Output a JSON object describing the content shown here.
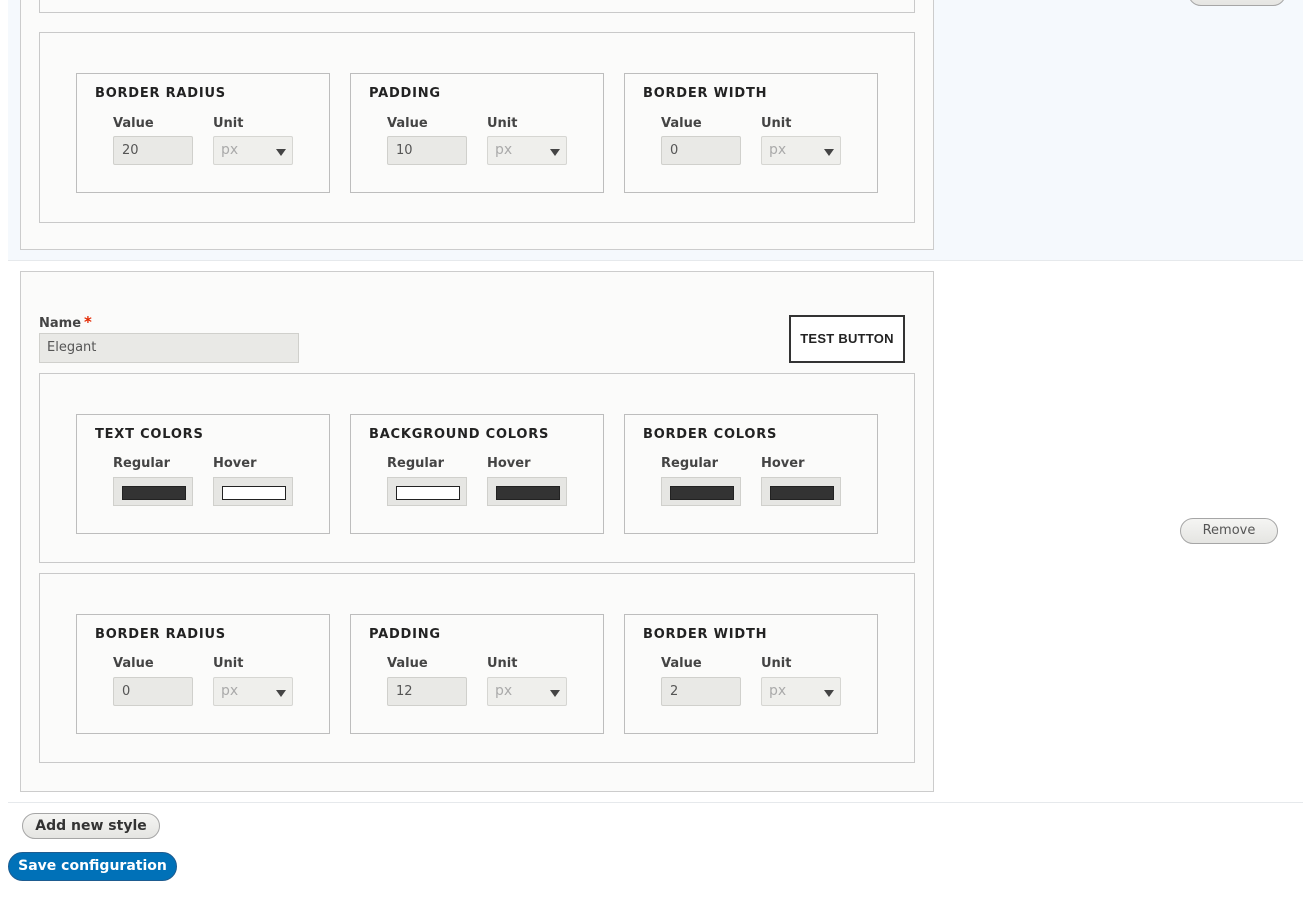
{
  "styles": [
    {
      "dimension_groups": [
        {
          "legend": "BORDER RADIUS",
          "value_label": "Value",
          "unit_label": "Unit",
          "value": "20",
          "unit": "px"
        },
        {
          "legend": "PADDING",
          "value_label": "Value",
          "unit_label": "Unit",
          "value": "10",
          "unit": "px"
        },
        {
          "legend": "BORDER WIDTH",
          "value_label": "Value",
          "unit_label": "Unit",
          "value": "0",
          "unit": "px"
        }
      ]
    },
    {
      "name_label": "Name",
      "required_mark": "*",
      "name_value": "Elegant",
      "preview_label": "TEST BUTTON",
      "color_groups": [
        {
          "legend": "TEXT COLORS",
          "regular_label": "Regular",
          "hover_label": "Hover",
          "regular": "#333333",
          "hover": "#ffffff"
        },
        {
          "legend": "BACKGROUND COLORS",
          "regular_label": "Regular",
          "hover_label": "Hover",
          "regular": "#ffffff",
          "hover": "#333333"
        },
        {
          "legend": "BORDER COLORS",
          "regular_label": "Regular",
          "hover_label": "Hover",
          "regular": "#333333",
          "hover": "#333333"
        }
      ],
      "dimension_groups": [
        {
          "legend": "BORDER RADIUS",
          "value_label": "Value",
          "unit_label": "Unit",
          "value": "0",
          "unit": "px"
        },
        {
          "legend": "PADDING",
          "value_label": "Value",
          "unit_label": "Unit",
          "value": "12",
          "unit": "px"
        },
        {
          "legend": "BORDER WIDTH",
          "value_label": "Value",
          "unit_label": "Unit",
          "value": "2",
          "unit": "px"
        }
      ],
      "remove_label": "Remove"
    }
  ],
  "actions": {
    "add_label": "Add new style",
    "save_label": "Save configuration"
  },
  "colors": {
    "primary": "#0071b8"
  }
}
